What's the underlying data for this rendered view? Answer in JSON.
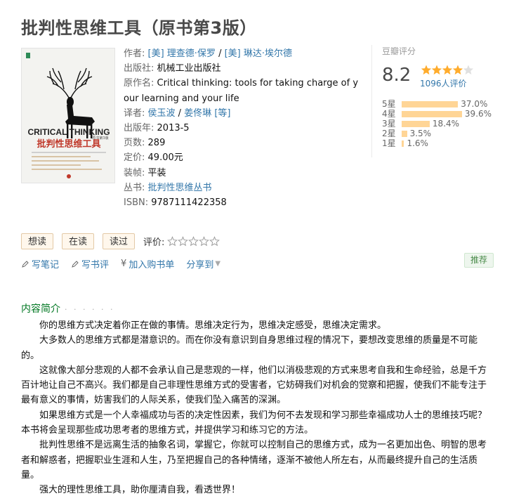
{
  "book": {
    "title": "批判性思维工具（原书第3版）"
  },
  "cover": {
    "title_en": "CRITICAL THINKING",
    "title_cn": "批判性思维工具",
    "note": "原书第3版"
  },
  "info": {
    "author_label": "作者:",
    "authors": [
      "[美] 理查德·保罗",
      "[美] 琳达·埃尔德"
    ],
    "author_sep": " / ",
    "publisher_label": "出版社:",
    "publisher": "机械工业出版社",
    "orig_title_label": "原作名:",
    "orig_title": "Critical thinking: tools for taking charge of your learning and your life",
    "translator_label": "译者:",
    "translators": [
      "侯玉波",
      "姜佟琳"
    ],
    "translator_extra": "[等]",
    "year_label": "出版年:",
    "year": "2013-5",
    "pages_label": "页数:",
    "pages": "289",
    "price_label": "定价:",
    "price": "49.00元",
    "binding_label": "装帧:",
    "binding": "平装",
    "series_label": "丛书:",
    "series": "批判性思维丛书",
    "isbn_label": "ISBN:",
    "isbn": "9787111422358"
  },
  "rating": {
    "title": "豆瓣评分",
    "score": "8.2",
    "stars": 4,
    "count_text": "1096人评价",
    "distribution": [
      {
        "label": "5星",
        "pct": "37.0%",
        "value": 37.0
      },
      {
        "label": "4星",
        "pct": "39.6%",
        "value": 39.6
      },
      {
        "label": "3星",
        "pct": "18.4%",
        "value": 18.4
      },
      {
        "label": "2星",
        "pct": "3.5%",
        "value": 3.5
      },
      {
        "label": "1星",
        "pct": "1.6%",
        "value": 1.6
      }
    ]
  },
  "buttons": {
    "want": "想读",
    "reading": "在读",
    "read": "读过",
    "rate_label": "评价:"
  },
  "actions": {
    "note": "写笔记",
    "review": "写书评",
    "cart": "加入购书单",
    "share": "分享到",
    "recommend": "推荐"
  },
  "intro": {
    "title": "内容简介",
    "dots": "· · · · · ·",
    "paragraphs": [
      "你的思维方式决定着你正在做的事情。思维决定行为，思维决定感受，思维决定需求。",
      "大多数人的思维方式都是潜意识的。而在你没有意识到自身思维过程的情况下，要想改变思维的质量是不可能的。",
      "这就像大部分悲观的人都不会承认自己是悲观的一样，他们以消极悲观的方式来思考自我和生命经验，总是千方百计地让自己不高兴。我们都是自己非理性思维方式的受害者，它妨碍我们对机会的觉察和把握，使我们不能专注于最有意义的事情，妨害我们的人际关系，使我们坠入痛苦的深渊。",
      "如果思维方式是一个人幸福成功与否的决定性因素，我们为何不去发现和学习那些幸福成功人士的思维技巧呢？本书将会呈现那些成功思考者的思维方式，并提供学习和练习它的方法。",
      "批判性思维不是远离生活的抽象名词，掌握它，你就可以控制自己的思维方式，成为一名更加出色、明智的思考者和解惑者，把握职业生涯和人生，乃至把握自己的各种情绪，逐渐不被他人所左右，从而最终提升自己的生活质量。",
      "强大的理性思维工具，助你厘清自我，看透世界！"
    ]
  },
  "colors": {
    "link": "#3377aa",
    "title": "#494949",
    "bar": "#ffd596",
    "section": "#007722",
    "star": "#ffac2d"
  }
}
